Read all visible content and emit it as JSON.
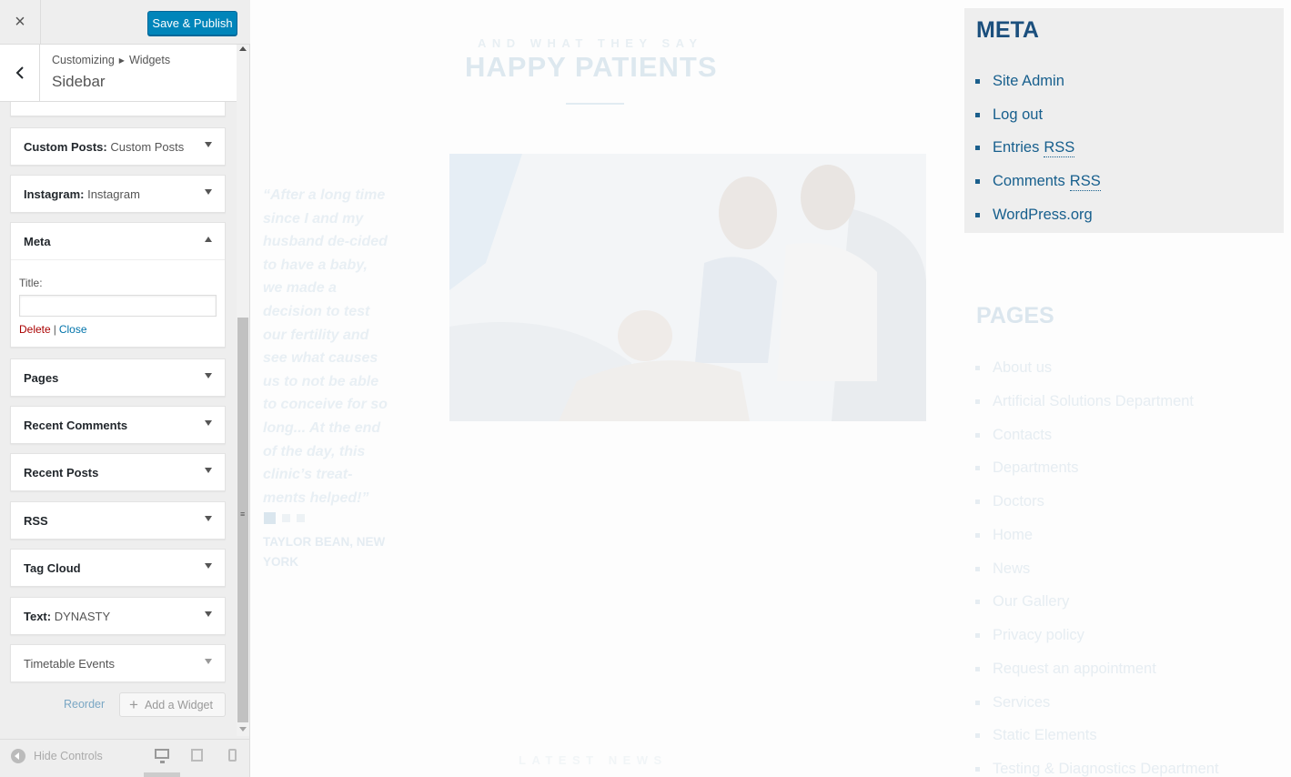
{
  "customizer": {
    "close_label": "×",
    "publish_label": "Save & Publish",
    "breadcrumb": [
      "Customizing",
      "Widgets"
    ],
    "section_title": "Sidebar",
    "widgets": [
      {
        "name": "Custom Posts",
        "sub": "Custom Posts",
        "state": "collapsed"
      },
      {
        "name": "Instagram",
        "sub": "Instagram",
        "state": "collapsed"
      },
      {
        "name": "Meta",
        "sub": "",
        "state": "expanded"
      },
      {
        "name": "Pages",
        "sub": "",
        "state": "collapsed"
      },
      {
        "name": "Recent Comments",
        "sub": "",
        "state": "collapsed"
      },
      {
        "name": "Recent Posts",
        "sub": "",
        "state": "collapsed"
      },
      {
        "name": "RSS",
        "sub": "",
        "state": "collapsed"
      },
      {
        "name": "Tag Cloud",
        "sub": "",
        "state": "collapsed"
      },
      {
        "name": "Text",
        "sub": "DYNASTY",
        "state": "collapsed"
      },
      {
        "name": "Timetable Events",
        "sub": "",
        "state": "collapsed"
      }
    ],
    "meta_form": {
      "title_label": "Title:",
      "title_value": "",
      "delete_label": "Delete",
      "separator": "|",
      "close_label": "Close"
    },
    "reorder_label": "Reorder",
    "add_widget_label": "Add a Widget",
    "hide_controls_label": "Hide Controls"
  },
  "preview": {
    "eyebrow": "AND WHAT THEY SAY",
    "title": "HAPPY PATIENTS",
    "quote": "“After a long time since I and my husband de-cided to have a baby, we made a decision to test our fertility and see what causes us to not be able to conceive for so long... At the end of the day, this clinic’s treat-ments helped!”",
    "author": "TAYLOR BEAN, NEW YORK",
    "meta": {
      "title": "META",
      "items": [
        "Site Admin",
        "Log out",
        "Entries",
        "Comments",
        "WordPress.org"
      ],
      "rss_label": "RSS"
    },
    "pages": {
      "title": "PAGES",
      "items": [
        "About us",
        "Artificial Solutions Department",
        "Contacts",
        "Departments",
        "Doctors",
        "Home",
        "News",
        "Our Gallery",
        "Privacy policy",
        "Request an appointment",
        "Services",
        "Static Elements",
        "Testing & Diagnostics Department"
      ]
    },
    "latest": "LATEST NEWS"
  }
}
